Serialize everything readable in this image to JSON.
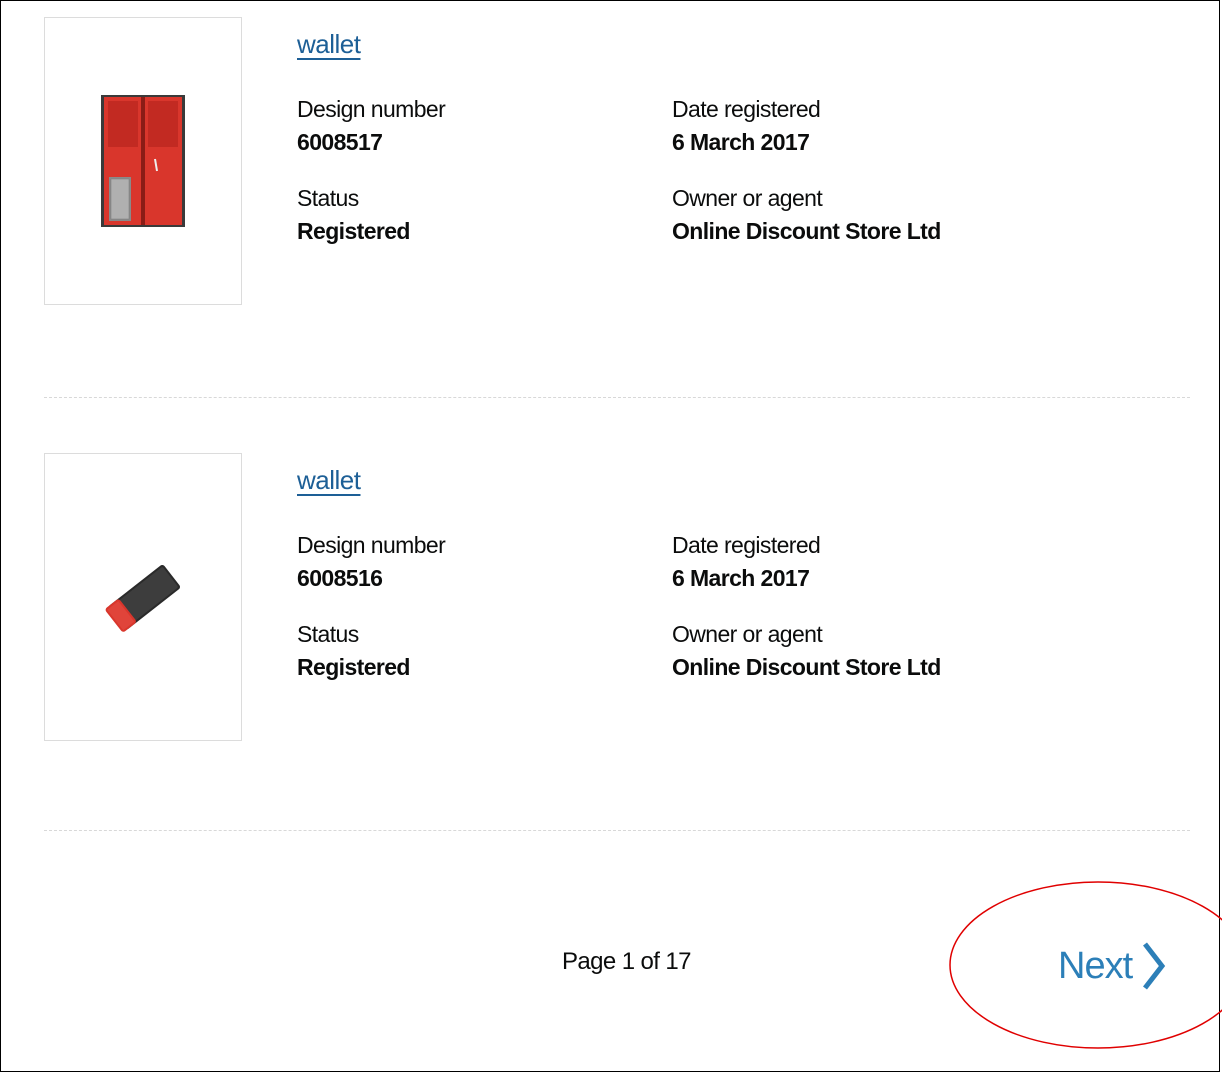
{
  "results": [
    {
      "title": "wallet",
      "design_number_label": "Design number",
      "design_number": "6008517",
      "date_registered_label": "Date registered",
      "date_registered": "6 March 2017",
      "status_label": "Status",
      "status": "Registered",
      "owner_label": "Owner or agent",
      "owner": "Online Discount Store Ltd",
      "image_icon": "red-open-wallet-image"
    },
    {
      "title": "wallet",
      "design_number_label": "Design number",
      "design_number": "6008516",
      "date_registered_label": "Date registered",
      "date_registered": "6 March 2017",
      "status_label": "Status",
      "status": "Registered",
      "owner_label": "Owner or agent",
      "owner": "Online Discount Store Ltd",
      "image_icon": "black-red-closed-wallet-image"
    }
  ],
  "pagination": {
    "info": "Page 1 of 17",
    "next_label": "Next",
    "next_icon": "chevron-right-icon"
  },
  "colors": {
    "link": "#1d5f96",
    "next": "#2c7fb8",
    "highlight": "#e00000"
  }
}
